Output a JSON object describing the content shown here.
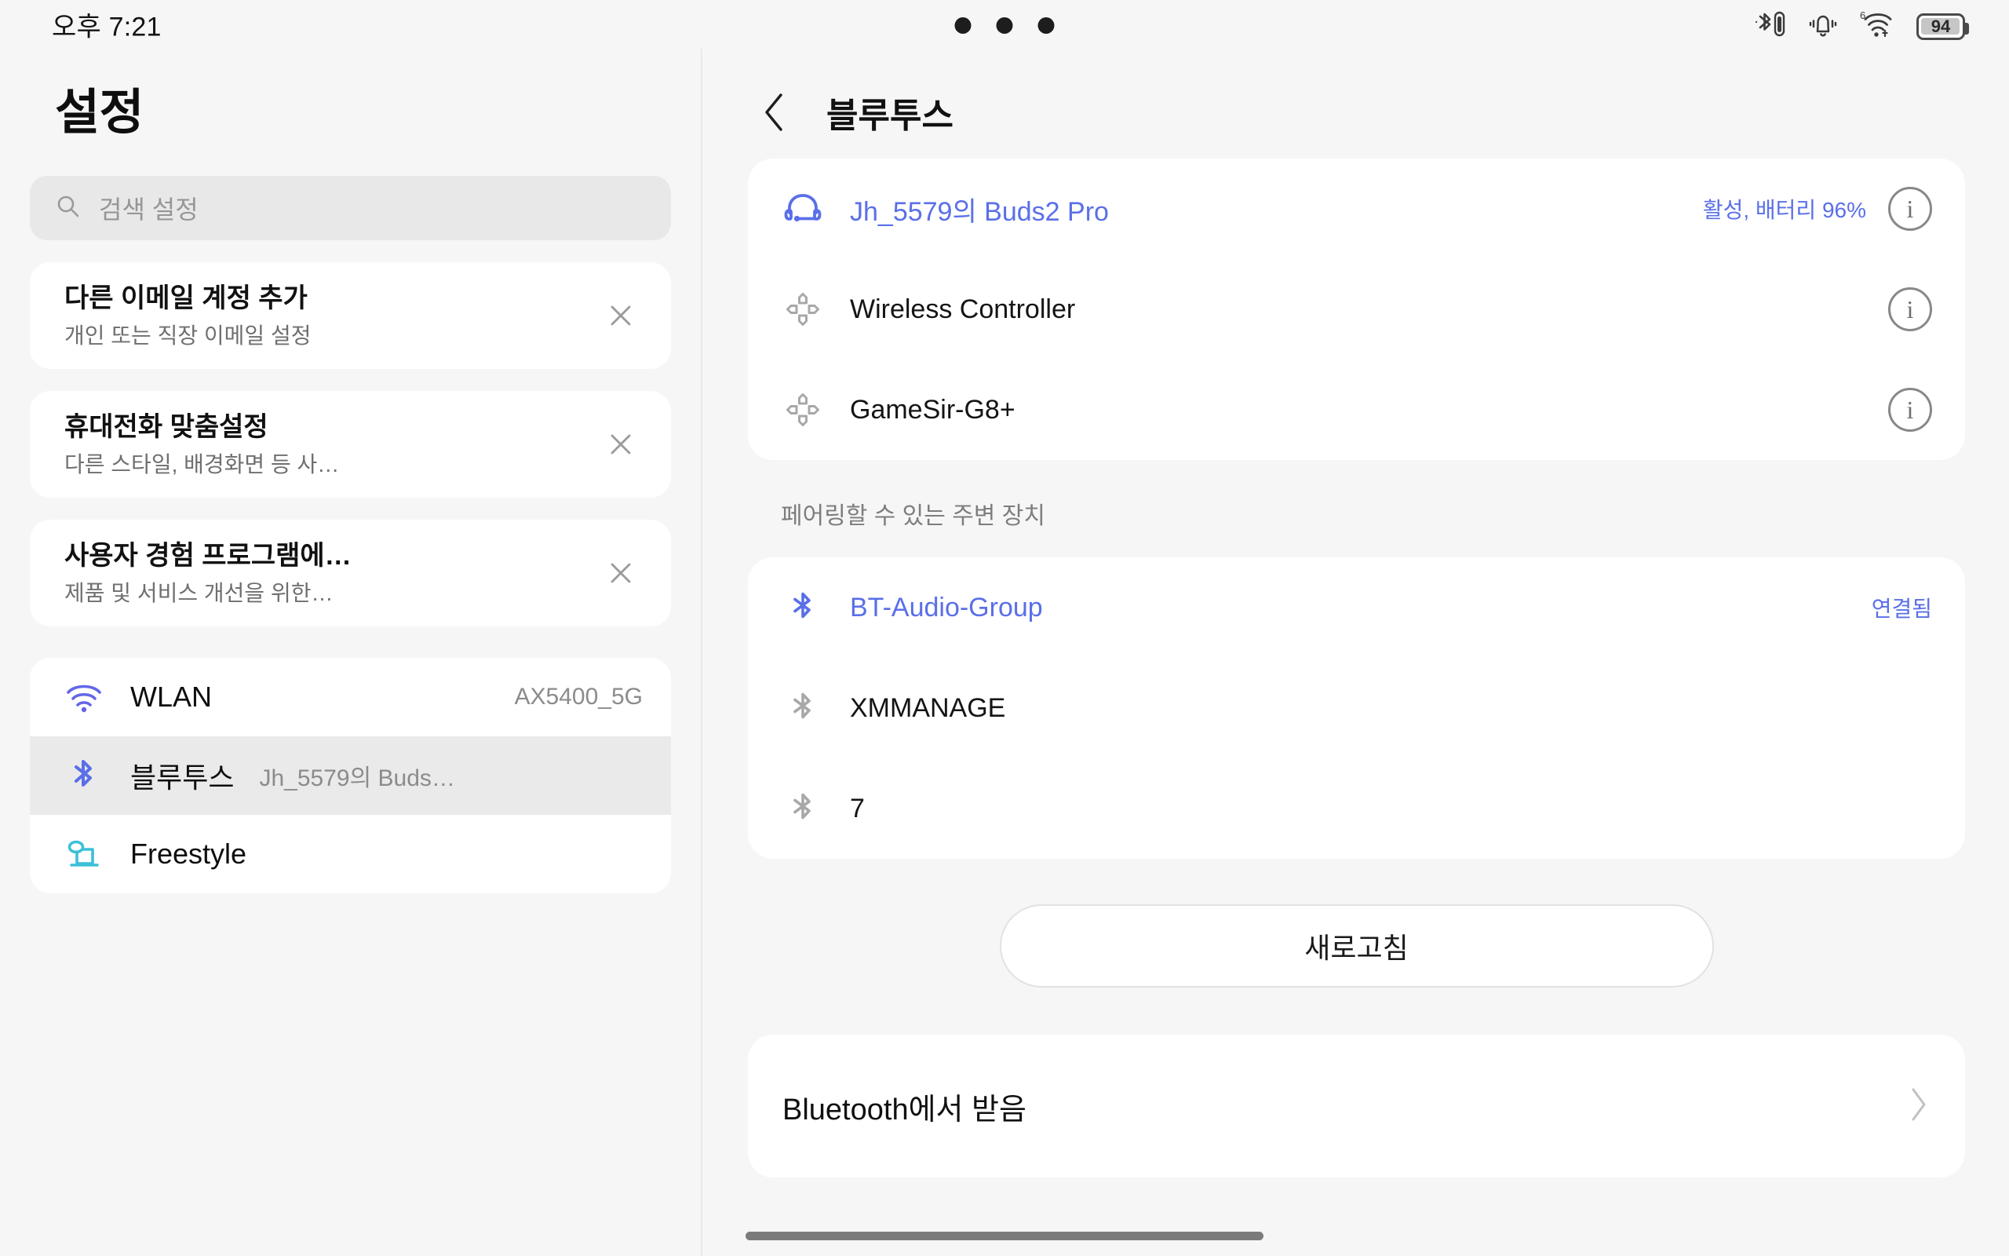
{
  "statusbar": {
    "time": "오후 7:21",
    "battery_level": "94",
    "icons": [
      "bluetooth-battery-icon",
      "bell-vibrate-icon",
      "wifi6-icon",
      "battery-icon"
    ],
    "wifi_generation": "6"
  },
  "sidebar": {
    "title": "설정",
    "search": {
      "placeholder": "검색 설정",
      "value": "",
      "icon": "search-icon"
    },
    "suggestion_cards": [
      {
        "title": "다른 이메일 계정 추가",
        "subtitle": "개인 또는 직장 이메일 설정",
        "dismiss": "close-icon"
      },
      {
        "title": "휴대전화 맞춤설정",
        "subtitle": "다른 스타일, 배경화면 등 사…",
        "dismiss": "close-icon"
      },
      {
        "title": "사용자 경험 프로그램에…",
        "subtitle": "제품 및 서비스 개선을 위한…",
        "dismiss": "close-icon"
      }
    ],
    "nav_items": [
      {
        "label": "WLAN",
        "value": "AX5400_5G",
        "icon": "wifi-icon",
        "selected": false
      },
      {
        "label": "블루투스",
        "value": "Jh_5579의 Buds…",
        "icon": "bluetooth-icon",
        "selected": true
      },
      {
        "label": "Freestyle",
        "value": "",
        "icon": "freestyle-projector-icon",
        "selected": false
      }
    ]
  },
  "detail": {
    "back_icon": "chevron-left-icon",
    "title": "블루투스",
    "paired_devices": [
      {
        "name": "Jh_5579의 Buds2 Pro",
        "status": "활성, 배터리 96%",
        "icon": "headset-icon",
        "highlighted": true,
        "info_icon": "info-icon"
      },
      {
        "name": "Wireless Controller",
        "status": "",
        "icon": "gamepad-dpad-icon",
        "highlighted": false,
        "info_icon": "info-icon"
      },
      {
        "name": "GameSir-G8+",
        "status": "",
        "icon": "gamepad-dpad-icon",
        "highlighted": false,
        "info_icon": "info-icon"
      }
    ],
    "available_section_title": "페어링할 수 있는 주변 장치",
    "available_devices": [
      {
        "name": "BT-Audio-Group",
        "status": "연결됨",
        "icon": "bluetooth-icon",
        "highlighted": true
      },
      {
        "name": "XMMANAGE",
        "status": "",
        "icon": "bluetooth-icon",
        "highlighted": false
      },
      {
        "name": "7",
        "status": "",
        "icon": "bluetooth-icon",
        "highlighted": false
      }
    ],
    "refresh_label": "새로고침",
    "received_label": "Bluetooth에서 받음",
    "received_chevron": "chevron-right-icon"
  },
  "colors": {
    "accent_blue": "#5a6fe8",
    "wifi_purple": "#6366e8",
    "freestyle_cyan": "#3cc0d8",
    "page_bg": "#f6f6f6",
    "card_bg": "#ffffff",
    "selected_bg": "#eaeaea"
  }
}
